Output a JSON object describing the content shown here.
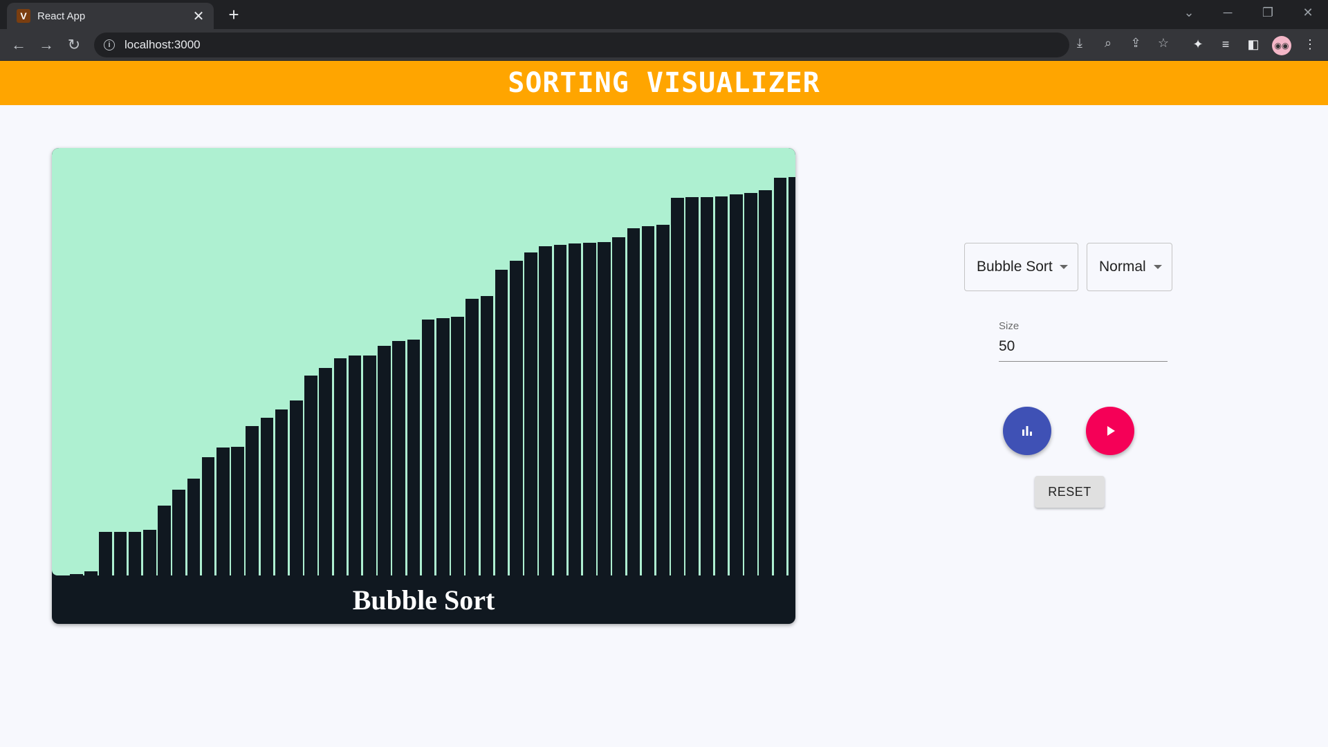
{
  "browser": {
    "tab_title": "React App",
    "favicon_letter": "V",
    "tab_close": "✕",
    "new_tab": "+",
    "url": "localhost:3000"
  },
  "app": {
    "title": "SORTING VISUALIZER"
  },
  "visualizer": {
    "caption": "Bubble Sort",
    "bar_color": "#101820",
    "background_color": "#aef0d1",
    "bar_count": 50,
    "bar_values": [
      2,
      6,
      63,
      63,
      63,
      66,
      101,
      124,
      140,
      171,
      185,
      186,
      216,
      228,
      240,
      253,
      289,
      300,
      314,
      318,
      318,
      332,
      339,
      341,
      370,
      372,
      374,
      400,
      404,
      442,
      455,
      467,
      476,
      478,
      480,
      481,
      482,
      489,
      502,
      505,
      507,
      546,
      547,
      547,
      548,
      551,
      553,
      557,
      575,
      576,
      582
    ]
  },
  "controls": {
    "algorithm_select": "Bubble Sort",
    "speed_select": "Normal",
    "size_label": "Size",
    "size_value": "50",
    "generate_icon": "bar-chart-icon",
    "play_icon": "play-icon",
    "reset_label": "RESET",
    "colors": {
      "generate_button": "#3f51b5",
      "play_button": "#f50057",
      "header": "#ffa500"
    }
  }
}
